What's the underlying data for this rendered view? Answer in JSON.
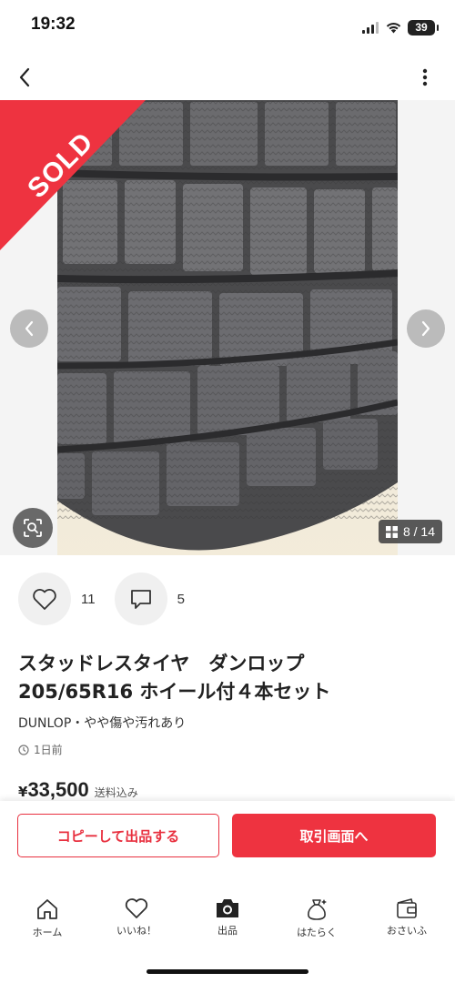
{
  "status_bar": {
    "time": "19:32",
    "battery": "39"
  },
  "product": {
    "sold_label": "SOLD",
    "image_counter": "8 / 14",
    "likes_count": "11",
    "comments_count": "5",
    "title": "スタッドレスタイヤ　ダンロップ\n205/65R16 ホイール付４本セット",
    "brand_condition": "DUNLOP・やや傷や汚れあり",
    "posted": "1日前",
    "price_currency": "¥",
    "price_value": "33,500",
    "price_note": "送料込み"
  },
  "buttons": {
    "copy_listing": "コピーして出品する",
    "trade_screen": "取引画面へ"
  },
  "tabs": [
    {
      "label": "ホーム",
      "icon": "home-icon"
    },
    {
      "label": "いいね！",
      "icon": "heart-icon"
    },
    {
      "label": "出品",
      "icon": "camera-icon"
    },
    {
      "label": "はたらく",
      "icon": "money-bag-icon"
    },
    {
      "label": "おさいふ",
      "icon": "wallet-icon"
    }
  ],
  "colors": {
    "accent": "#ee3340",
    "sold_ribbon": "#ee3340"
  }
}
